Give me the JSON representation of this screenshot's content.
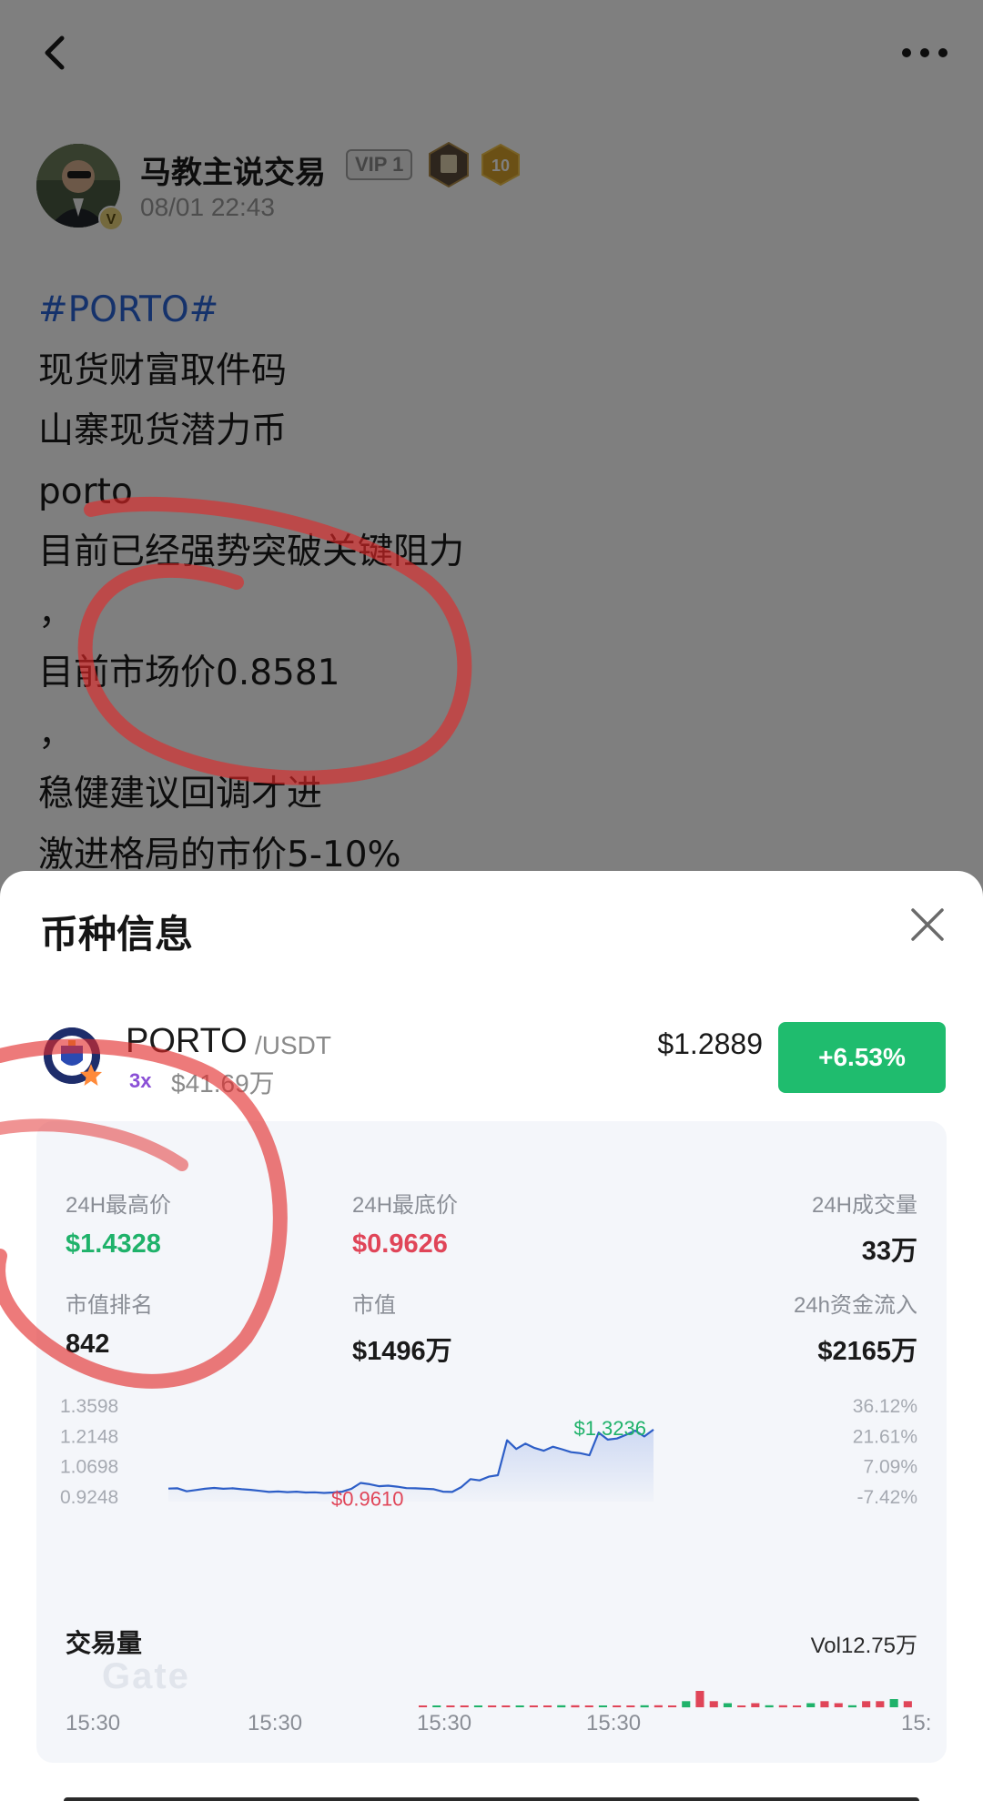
{
  "post": {
    "author": "马教主说交易",
    "vip": "VIP 1",
    "level": "10",
    "time": "08/01 22:43",
    "hashtag": "#PORTO#",
    "lines": [
      "现货财富取件码",
      "山寨现货潜力币",
      "porto",
      "目前已经强势突破关键阻力",
      "，",
      "目前市场价0.8581",
      "，",
      "稳健建议回调才进",
      "激进格局的市价5-10%"
    ]
  },
  "sheet": {
    "title": "币种信息",
    "coin": {
      "name": "PORTO",
      "quote": "/USDT",
      "leverage": "3x",
      "cap": "$41.69万",
      "price": "$1.2889",
      "change": "+6.53%"
    },
    "stats": {
      "high_label": "24H最高价",
      "high_value": "$1.4328",
      "low_label": "24H最底价",
      "low_value": "$0.9626",
      "volume_label": "24H成交量",
      "volume_value": "33万",
      "rank_label": "市值排名",
      "rank_value": "842",
      "mcap_label": "市值",
      "mcap_value": "$1496万",
      "inflow_label": "24h资金流入",
      "inflow_value": "$2165万"
    },
    "trading_volume_label": "交易量",
    "trading_volume_value": "Vol12.75万",
    "watermark": "Gate"
  },
  "chart_data": {
    "type": "area",
    "y_left_ticks": [
      "1.3598",
      "1.2148",
      "1.0698",
      "0.9248"
    ],
    "y_right_ticks": [
      "36.12%",
      "21.61%",
      "7.09%",
      "-7.42%"
    ],
    "x_ticks": [
      "15:30",
      "15:30",
      "15:30",
      "15:30",
      "15:"
    ],
    "ylim": [
      0.9248,
      1.3598
    ],
    "annotations": {
      "max": "$1.3236",
      "min": "$0.9610"
    },
    "values": [
      0.961,
      0.962,
      0.948,
      0.954,
      0.96,
      0.964,
      0.96,
      0.962,
      0.958,
      0.955,
      0.95,
      0.945,
      0.947,
      0.944,
      0.946,
      0.942,
      0.943,
      0.94,
      0.942,
      0.946,
      0.96,
      0.988,
      0.982,
      0.972,
      0.975,
      0.97,
      0.963,
      0.962,
      0.96,
      0.958,
      0.946,
      0.945,
      0.968,
      1.006,
      1.0,
      1.018,
      1.025,
      1.192,
      1.15,
      1.176,
      1.155,
      1.142,
      1.161,
      1.149,
      1.135,
      1.13,
      1.12,
      1.229,
      1.195,
      1.2,
      1.218,
      1.238,
      1.21,
      1.243
    ],
    "colors": {
      "line": "#2d5ec7",
      "max": "#1fb26a",
      "min": "#e04558"
    }
  },
  "volume_data": {
    "type": "bar",
    "values": [
      0,
      0,
      0,
      0,
      0,
      0,
      0,
      0,
      0,
      0,
      1,
      1,
      0,
      0,
      0,
      0,
      1,
      1,
      0,
      3,
      8,
      3,
      2,
      0,
      2,
      1,
      1,
      0,
      2,
      3,
      2,
      1,
      3,
      3,
      4,
      3
    ],
    "up_color": "#1fb26a",
    "down_color": "#e04558"
  }
}
